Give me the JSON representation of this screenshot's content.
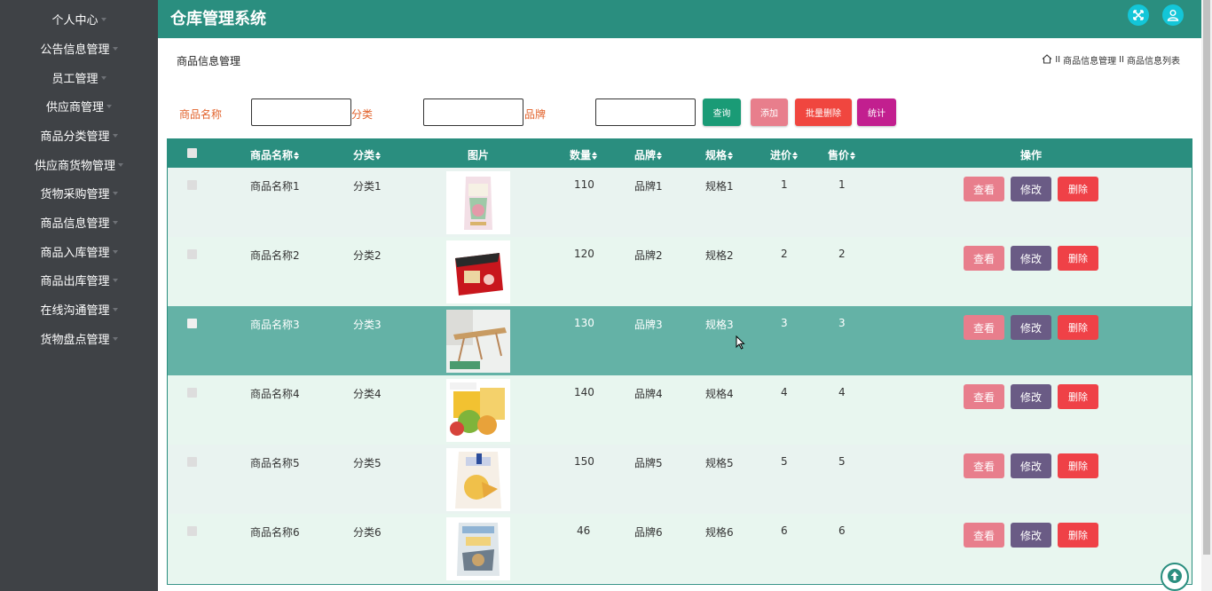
{
  "app": {
    "title": "仓库管理系统"
  },
  "sidebar": {
    "items": [
      {
        "label": "个人中心"
      },
      {
        "label": "公告信息管理"
      },
      {
        "label": "员工管理"
      },
      {
        "label": "供应商管理"
      },
      {
        "label": "商品分类管理"
      },
      {
        "label": "供应商货物管理"
      },
      {
        "label": "货物采购管理"
      },
      {
        "label": "商品信息管理"
      },
      {
        "label": "商品入库管理"
      },
      {
        "label": "商品出库管理"
      },
      {
        "label": "在线沟通管理"
      },
      {
        "label": "货物盘点管理"
      }
    ]
  },
  "page": {
    "title": "商品信息管理",
    "breadcrumb": {
      "sep": "II",
      "level1": "商品信息管理",
      "level2": "商品信息列表"
    }
  },
  "filters": {
    "name_label": "商品名称",
    "category_label": "分类",
    "brand_label": "品牌",
    "name_value": "",
    "category_value": "",
    "brand_value": ""
  },
  "buttons": {
    "query": "查询",
    "add": "添加",
    "batch_delete": "批量删除",
    "stats": "统计"
  },
  "table": {
    "headers": {
      "name": "商品名称",
      "category": "分类",
      "image": "图片",
      "quantity": "数量",
      "brand": "品牌",
      "spec": "规格",
      "cost": "进价",
      "price": "售价",
      "actions": "操作"
    },
    "action_labels": {
      "view": "查看",
      "edit": "修改",
      "delete": "删除"
    },
    "rows": [
      {
        "name": "商品名称1",
        "category": "分类1",
        "quantity": "110",
        "brand": "品牌1",
        "spec": "规格1",
        "cost": "1",
        "price": "1",
        "image": "rice-bag"
      },
      {
        "name": "商品名称2",
        "category": "分类2",
        "quantity": "120",
        "brand": "品牌2",
        "spec": "规格2",
        "cost": "2",
        "price": "2",
        "image": "snack-box"
      },
      {
        "name": "商品名称3",
        "category": "分类3",
        "quantity": "130",
        "brand": "品牌3",
        "spec": "规格3",
        "cost": "3",
        "price": "3",
        "image": "folding-table"
      },
      {
        "name": "商品名称4",
        "category": "分类4",
        "quantity": "140",
        "brand": "品牌4",
        "spec": "规格4",
        "cost": "4",
        "price": "4",
        "image": "pastry-box"
      },
      {
        "name": "商品名称5",
        "category": "分类5",
        "quantity": "150",
        "brand": "品牌5",
        "spec": "规格5",
        "cost": "5",
        "price": "5",
        "image": "bread-bag"
      },
      {
        "name": "商品名称6",
        "category": "分类6",
        "quantity": "46",
        "brand": "品牌6",
        "spec": "规格6",
        "cost": "6",
        "price": "6",
        "image": "snack-bag"
      }
    ]
  },
  "colors": {
    "sidebar_bg": "#3f4246",
    "header_bg": "#2a8e7f",
    "query_btn": "#1a9b76",
    "add_btn": "#e87e8c",
    "batch_delete_btn": "#f0463f",
    "stats_btn": "#c21f8f",
    "highlight_row": "#64b2a6"
  },
  "icons": {
    "fullscreen": "fullscreen-icon",
    "user": "user-icon",
    "home": "home-icon",
    "back_to_top": "arrow-up-icon"
  }
}
